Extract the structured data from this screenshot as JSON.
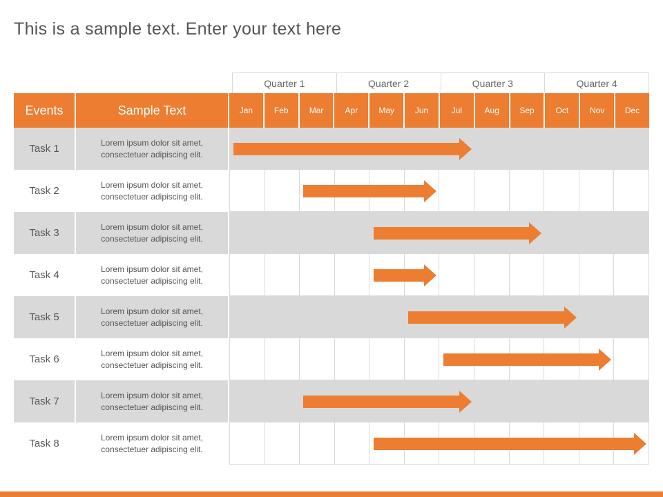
{
  "title": "This is a sample text. Enter your text here",
  "headers": {
    "events": "Events",
    "sample": "Sample Text",
    "quarters": [
      "Quarter 1",
      "Quarter 2",
      "Quarter 3",
      "Quarter 4"
    ],
    "months": [
      "Jan",
      "Feb",
      "Mar",
      "Apr",
      "May",
      "Jun",
      "Jul",
      "Aug",
      "Sep",
      "Oct",
      "Nov",
      "Dec"
    ]
  },
  "rows": [
    {
      "task": "Task 1",
      "desc": "Lorem ipsum dolor sit amet, consectetuer adipiscing elit."
    },
    {
      "task": "Task 2",
      "desc": "Lorem ipsum dolor sit amet, consectetuer adipiscing elit."
    },
    {
      "task": "Task 3",
      "desc": "Lorem ipsum dolor sit amet, consectetuer adipiscing elit."
    },
    {
      "task": "Task 4",
      "desc": "Lorem ipsum dolor sit amet, consectetuer adipiscing elit."
    },
    {
      "task": "Task 5",
      "desc": "Lorem ipsum dolor sit amet, consectetuer adipiscing elit."
    },
    {
      "task": "Task 6",
      "desc": "Lorem ipsum dolor sit amet, consectetuer adipiscing elit."
    },
    {
      "task": "Task 7",
      "desc": "Lorem ipsum dolor sit amet, consectetuer adipiscing elit."
    },
    {
      "task": "Task 8",
      "desc": "Lorem ipsum dolor sit amet, consectetuer adipiscing elit."
    }
  ],
  "colors": {
    "accent": "#ed7d31",
    "grey": "#d9d9d9"
  },
  "chart_data": {
    "type": "bar",
    "title": "This is a sample text. Enter your text here",
    "xlabel": "",
    "ylabel": "",
    "categories": [
      "Jan",
      "Feb",
      "Mar",
      "Apr",
      "May",
      "Jun",
      "Jul",
      "Aug",
      "Sep",
      "Oct",
      "Nov",
      "Dec"
    ],
    "series": [
      {
        "name": "Task 1",
        "start": 1,
        "end": 7
      },
      {
        "name": "Task 2",
        "start": 3,
        "end": 6
      },
      {
        "name": "Task 3",
        "start": 5,
        "end": 9
      },
      {
        "name": "Task 4",
        "start": 5,
        "end": 6
      },
      {
        "name": "Task 5",
        "start": 6,
        "end": 10
      },
      {
        "name": "Task 6",
        "start": 7,
        "end": 11
      },
      {
        "name": "Task 7",
        "start": 3,
        "end": 7
      },
      {
        "name": "Task 8",
        "start": 5,
        "end": 12
      }
    ],
    "ylim": [
      1,
      12
    ]
  }
}
